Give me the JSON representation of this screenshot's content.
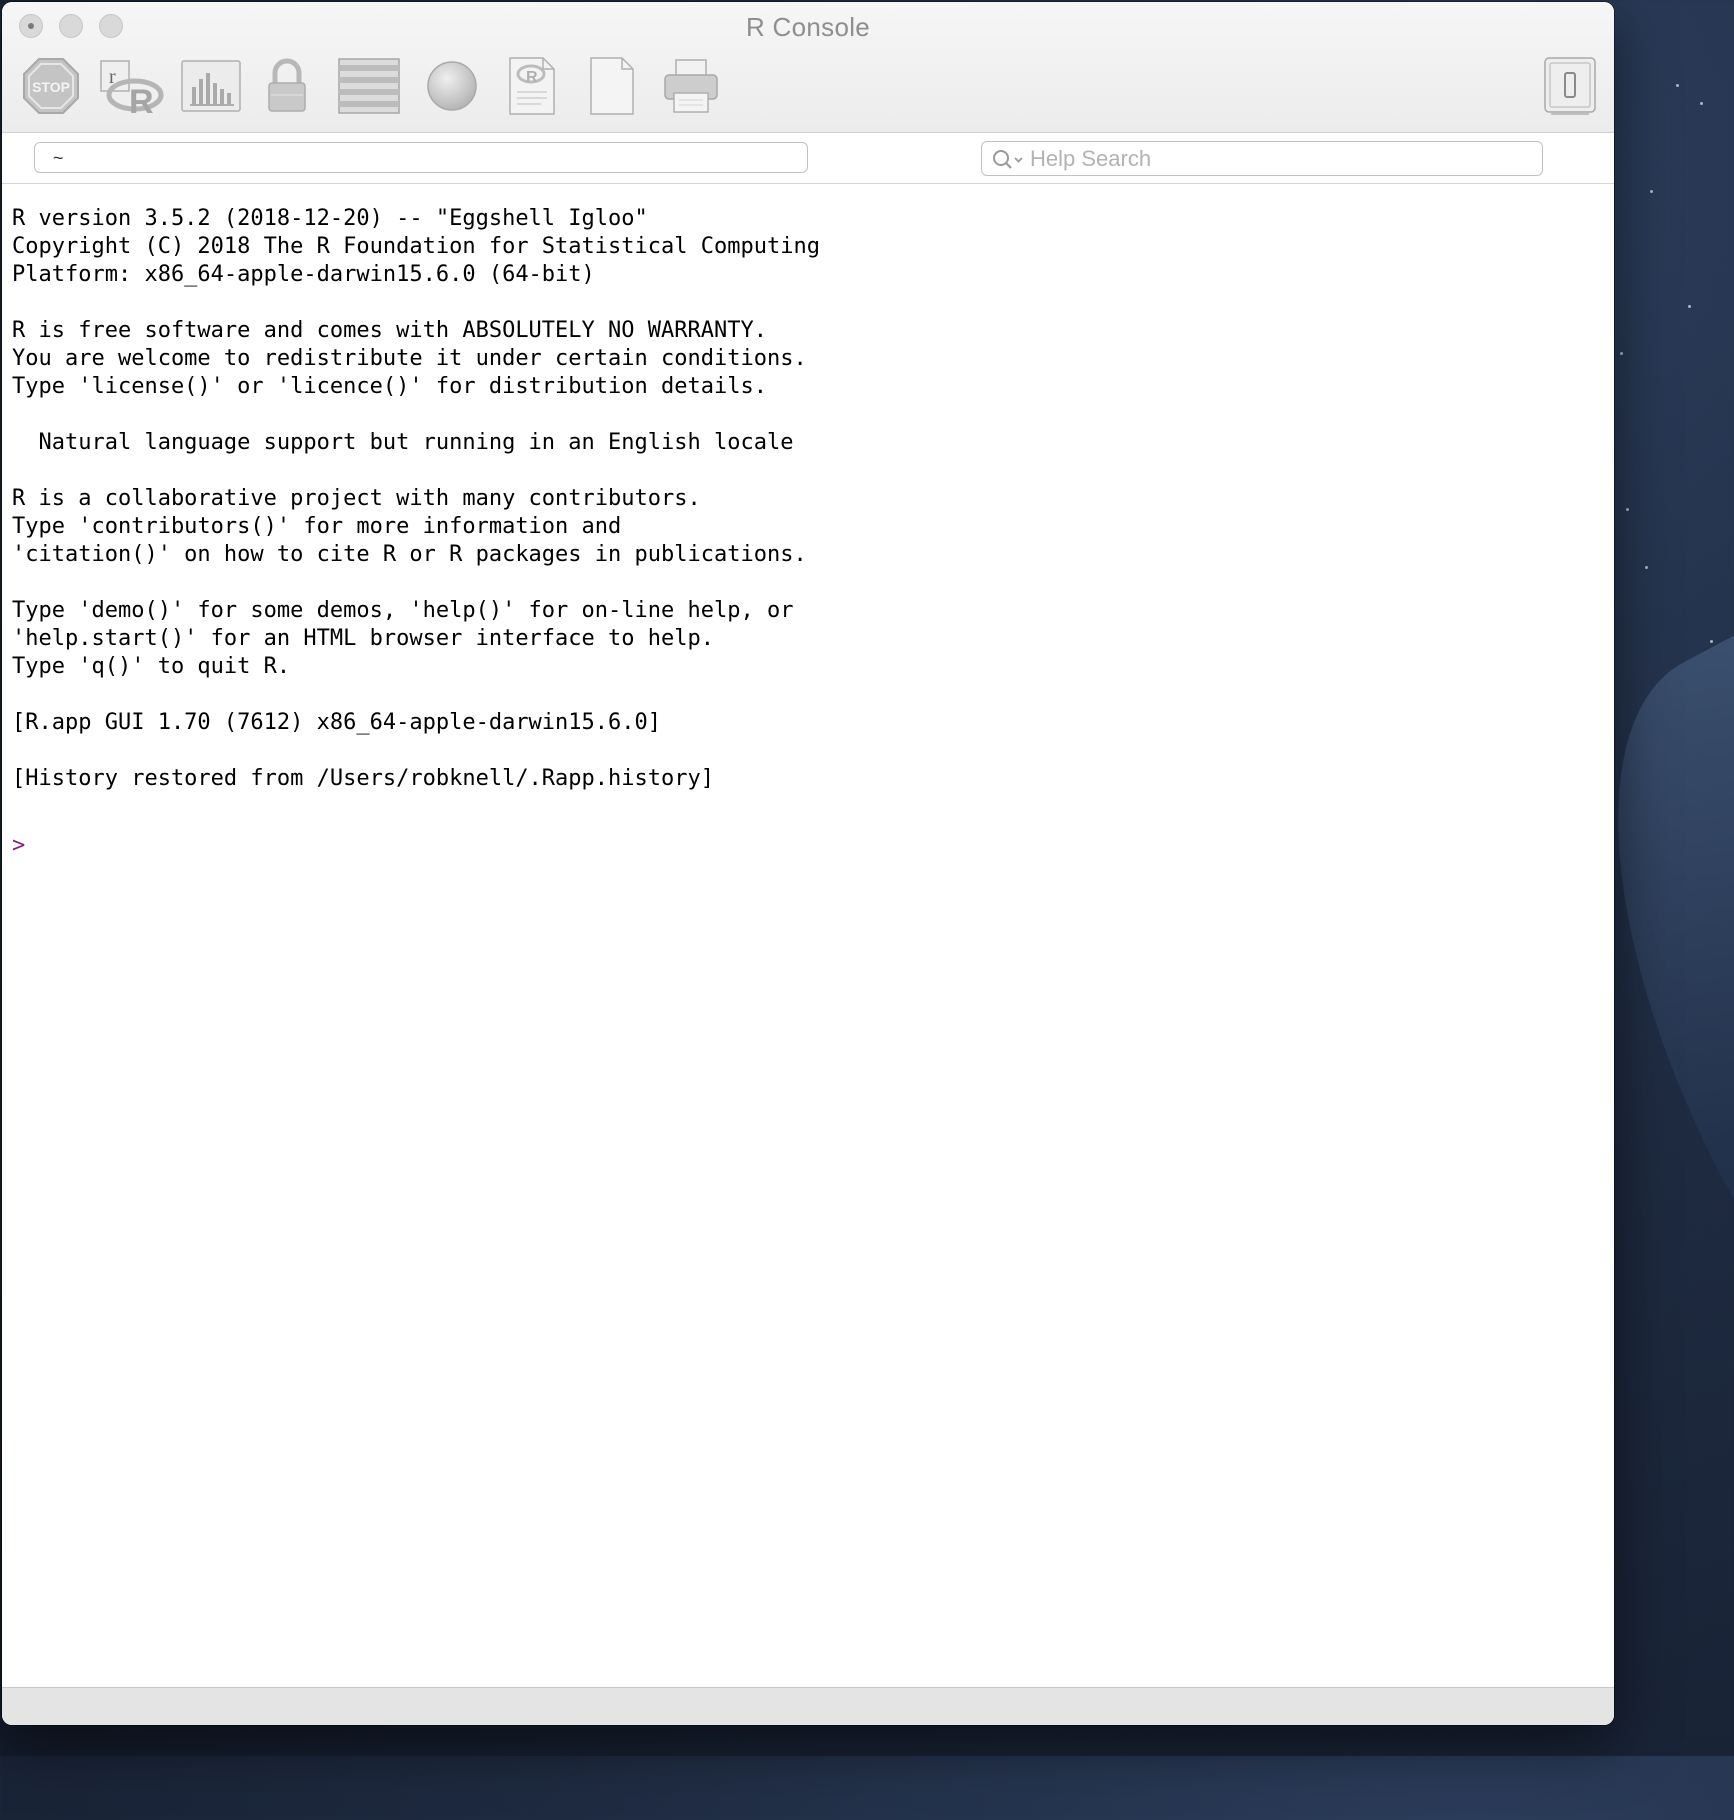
{
  "window": {
    "title": "R Console"
  },
  "toolbar": {
    "buttons": [
      {
        "icon": "stop-icon",
        "label": "STOP"
      },
      {
        "icon": "source-r-script-icon",
        "label": "r"
      },
      {
        "icon": "quartz-graphics-icon"
      },
      {
        "icon": "lock-icon"
      },
      {
        "icon": "data-editor-icon"
      },
      {
        "icon": "circle-icon"
      },
      {
        "icon": "r-document-icon"
      },
      {
        "icon": "new-document-icon"
      },
      {
        "icon": "print-icon"
      },
      {
        "icon": "drawer-toggle-icon"
      }
    ]
  },
  "path_field": {
    "value": "~"
  },
  "help_search": {
    "placeholder": "Help Search",
    "value": ""
  },
  "console": {
    "output": "R version 3.5.2 (2018-12-20) -- \"Eggshell Igloo\"\nCopyright (C) 2018 The R Foundation for Statistical Computing\nPlatform: x86_64-apple-darwin15.6.0 (64-bit)\n\nR is free software and comes with ABSOLUTELY NO WARRANTY.\nYou are welcome to redistribute it under certain conditions.\nType 'license()' or 'licence()' for distribution details.\n\n  Natural language support but running in an English locale\n\nR is a collaborative project with many contributors.\nType 'contributors()' for more information and\n'citation()' on how to cite R or R packages in publications.\n\nType 'demo()' for some demos, 'help()' for on-line help, or\n'help.start()' for an HTML browser interface to help.\nType 'q()' to quit R.\n\n[R.app GUI 1.70 (7612) x86_64-apple-darwin15.6.0]\n\n[History restored from /Users/robknell/.Rapp.history]",
    "prompt": ">"
  },
  "colors": {
    "prompt": "#8b1c8b",
    "toolbar_icon": "#b5b5b5"
  }
}
